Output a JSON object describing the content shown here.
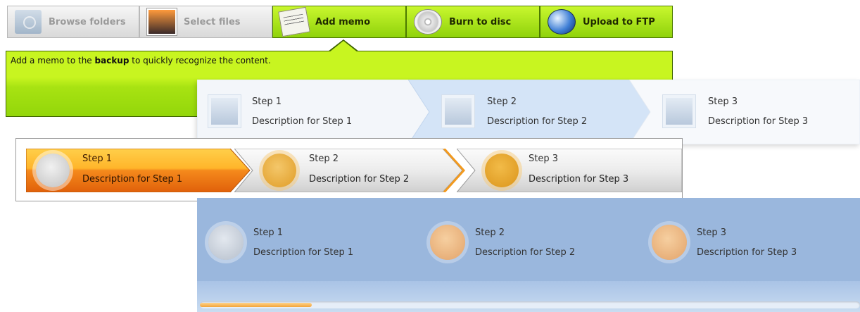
{
  "toolbar": {
    "buttons": [
      {
        "label": "Browse folders",
        "icon": "folder-icon",
        "state": "disabled"
      },
      {
        "label": "Select files",
        "icon": "photos-icon",
        "state": "disabled"
      },
      {
        "label": "Add memo",
        "icon": "memo-icon",
        "state": "active"
      },
      {
        "label": "Burn to disc",
        "icon": "disc-icon",
        "state": "enabled"
      },
      {
        "label": "Upload to FTP",
        "icon": "globe-icon",
        "state": "enabled"
      }
    ]
  },
  "memo": {
    "text_before": "Add a memo to the ",
    "text_bold": "backup",
    "text_after": " to quickly recognize the content."
  },
  "wizard_a": {
    "steps": [
      {
        "title": "Step 1",
        "description": "Description for Step 1"
      },
      {
        "title": "Step 2",
        "description": "Description for Step 2"
      },
      {
        "title": "Step 3",
        "description": "Description for Step 3"
      }
    ]
  },
  "wizard_b": {
    "steps": [
      {
        "title": "Step 1",
        "description": "Description for Step 1"
      },
      {
        "title": "Step 2",
        "description": "Description for Step 2"
      },
      {
        "title": "Step 3",
        "description": "Description for Step 3"
      }
    ]
  },
  "wizard_c": {
    "steps": [
      {
        "title": "Step 1",
        "description": "Description for Step 1"
      },
      {
        "title": "Step 2",
        "description": "Description for Step 2"
      },
      {
        "title": "Step 3",
        "description": "Description for Step 3"
      }
    ],
    "progress_fraction": 0.17
  },
  "colors": {
    "accent_green": "#a8e312",
    "accent_orange": "#f07a1a",
    "panel_blue": "#9ab7dd"
  }
}
